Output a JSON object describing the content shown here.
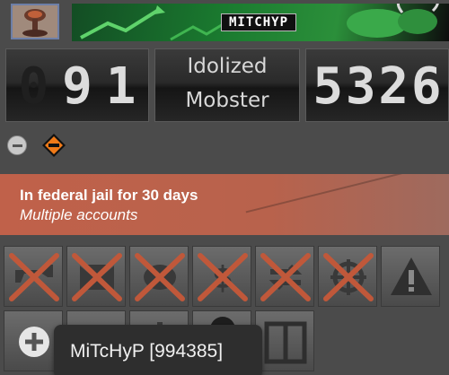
{
  "header": {
    "banner_name": "MITCHYP",
    "avatar_icon": "mushroom-cloud-icon"
  },
  "counters": {
    "left_digits": [
      "0",
      "9",
      "1"
    ],
    "left_value": 91,
    "rank_line1": "Idolized",
    "rank_line2": "Mobster",
    "right_digits": [
      "5",
      "3",
      "2",
      "6"
    ],
    "right_value": 5326
  },
  "status_icons": [
    "minus-circle-icon",
    "warning-diamond-icon"
  ],
  "jail": {
    "title": "In federal jail for 30 days",
    "reason": "Multiple accounts",
    "color": "#c0614a"
  },
  "actions": {
    "row1": [
      {
        "icon": "attack-icon",
        "disabled": true
      },
      {
        "icon": "message-icon",
        "disabled": true
      },
      {
        "icon": "bust-icon",
        "disabled": true
      },
      {
        "icon": "send-money-icon",
        "disabled": true
      },
      {
        "icon": "trade-icon",
        "disabled": true
      },
      {
        "icon": "bounty-icon",
        "disabled": true
      },
      {
        "icon": "report-icon",
        "disabled": false
      }
    ],
    "row2": [
      {
        "icon": "add-friend-icon"
      },
      {
        "icon": "view-profile-icon"
      },
      {
        "icon": "more-icon"
      },
      {
        "icon": "globe-icon"
      },
      {
        "icon": "compare-icon"
      }
    ]
  },
  "tooltip": {
    "text": "MiTcHyP [994385]"
  },
  "colors": {
    "disabled_x": "#c0583a",
    "banner_green": "#1a7a2f"
  }
}
